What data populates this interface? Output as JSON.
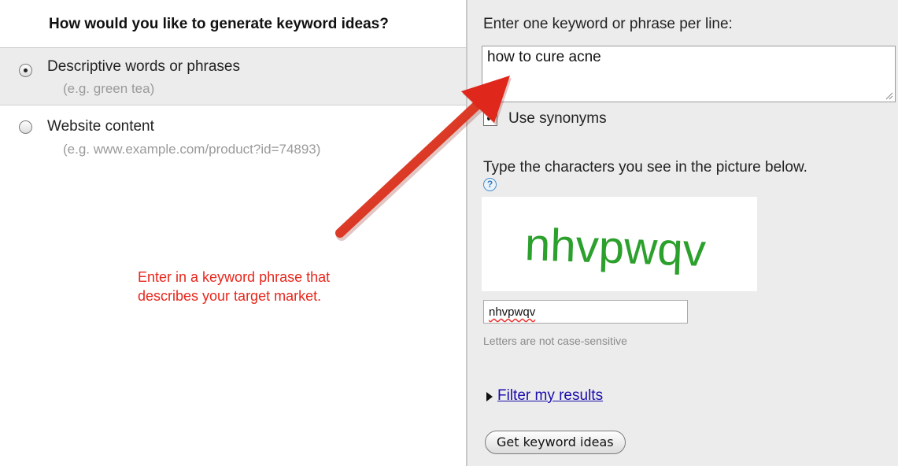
{
  "left": {
    "title": "How would you like to generate keyword ideas?",
    "options": [
      {
        "label": "Descriptive words or phrases",
        "hint": "(e.g. green tea)",
        "selected": true
      },
      {
        "label": "Website content",
        "hint": "(e.g. www.example.com/product?id=74893)",
        "selected": false
      }
    ],
    "annotation": "Enter in a keyword phrase that describes your target market."
  },
  "right": {
    "keyword_label": "Enter one keyword or phrase per line:",
    "keyword_value": "how to cure acne",
    "synonyms_label": "Use synonyms",
    "synonyms_checked": true,
    "captcha_label": "Type the characters you see in the picture below.",
    "help_glyph": "?",
    "captcha_text": "nhvpwqv",
    "captcha_input_value": "nhvpwqv",
    "captcha_hint": "Letters are not case-sensitive",
    "filter_link": "Filter my results",
    "submit_label": "Get keyword ideas"
  },
  "colors": {
    "annotation": "#e8261b",
    "arrow": "#e0271b",
    "captcha_text": "#2ca02c",
    "link": "#1a0dab"
  },
  "icons": [
    "radio-selected-icon",
    "radio-unselected-icon",
    "checkbox-checked-icon",
    "help-icon",
    "resize-grip-icon",
    "disclosure-triangle-icon",
    "annotation-arrow-icon"
  ]
}
